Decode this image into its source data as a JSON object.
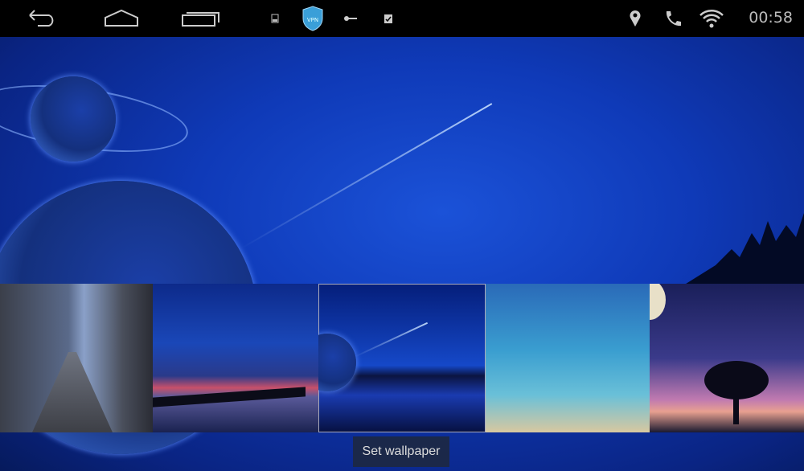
{
  "status_bar": {
    "time": "00:58",
    "nav": [
      "back-icon",
      "home-icon",
      "recents-icon"
    ],
    "notifications": [
      "image-icon",
      "vpn-shield-icon",
      "key-icon",
      "clipboard-check-icon"
    ],
    "vpn_label": "VPN",
    "system": [
      "location-icon",
      "phone-icon",
      "wifi-icon"
    ]
  },
  "wallpaper_picker": {
    "thumbnails": [
      {
        "name": "city-street"
      },
      {
        "name": "pier-sunset"
      },
      {
        "name": "blue-planet",
        "selected": true
      },
      {
        "name": "teal-gradient"
      },
      {
        "name": "starry-tree"
      }
    ],
    "set_wallpaper_label": "Set wallpaper"
  }
}
